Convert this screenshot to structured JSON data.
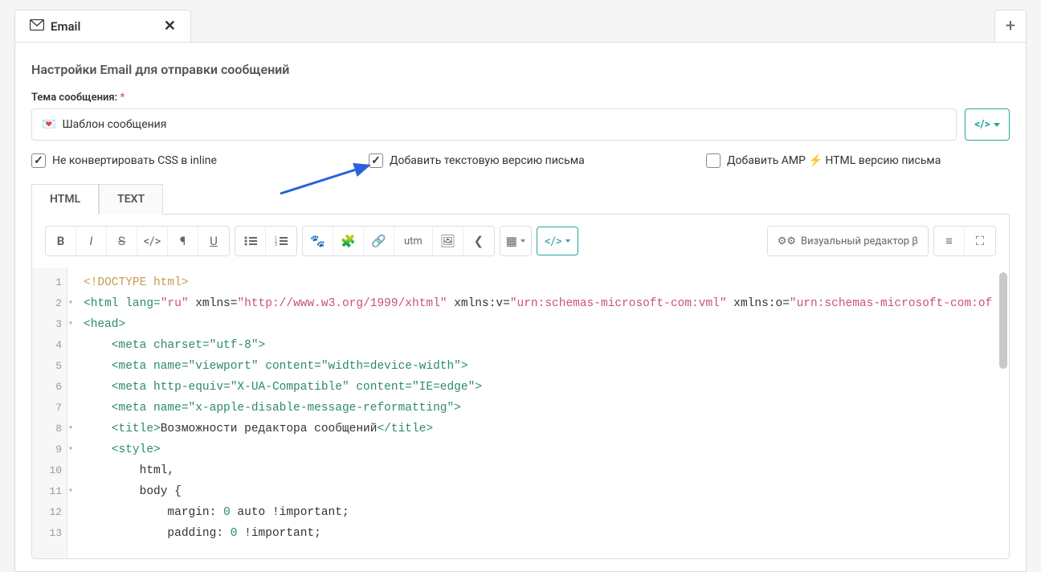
{
  "tab": {
    "label": "Email"
  },
  "section_title": "Настройки Email для отправки сообщений",
  "subject": {
    "label": "Тема сообщения:",
    "value": "Шаблон сообщения"
  },
  "checkboxes": {
    "no_inline_css": "Не конвертировать CSS в inline",
    "add_text_version": "Добавить текстовую версию письма",
    "add_amp_prefix": "Добавить AMP",
    "add_amp_suffix": "HTML версию письма"
  },
  "editor_tabs": {
    "html": "HTML",
    "text": "TEXT"
  },
  "toolbar": {
    "utm": "utm",
    "visual_editor": "Визуальный редактор β"
  },
  "code": {
    "l1": "<!DOCTYPE html>",
    "l2_pre": "<html lang=",
    "l2_lang": "\"ru\"",
    "l2_xmlns": " xmlns=",
    "l2_xmlns_v": "\"http://www.w3.org/1999/xhtml\"",
    "l2_xv": " xmlns:v=",
    "l2_xv_v": "\"urn:schemas-microsoft-com:vml\"",
    "l2_xo": " xmlns:o=",
    "l2_xo_v": "\"urn:schemas-microsoft-com:of",
    "l3": "<head>",
    "l4": "    <meta charset=\"utf-8\">",
    "l5": "    <meta name=\"viewport\" content=\"width=device-width\">",
    "l6": "    <meta http-equiv=\"X-UA-Compatible\" content=\"IE=edge\">",
    "l7": "    <meta name=\"x-apple-disable-message-reformatting\">",
    "l8_open": "    <title>",
    "l8_txt": "Возможности редактора сообщений",
    "l8_close": "</title>",
    "l9": "    <style>",
    "l10": "        html,",
    "l11": "        body {",
    "l12_a": "            margin: ",
    "l12_b": "0",
    "l12_c": " auto !important;",
    "l13_a": "            padding: ",
    "l13_b": "0",
    "l13_c": " !important;"
  },
  "line_numbers": [
    "1",
    "2",
    "3",
    "4",
    "5",
    "6",
    "7",
    "8",
    "9",
    "10",
    "11",
    "12",
    "13"
  ]
}
